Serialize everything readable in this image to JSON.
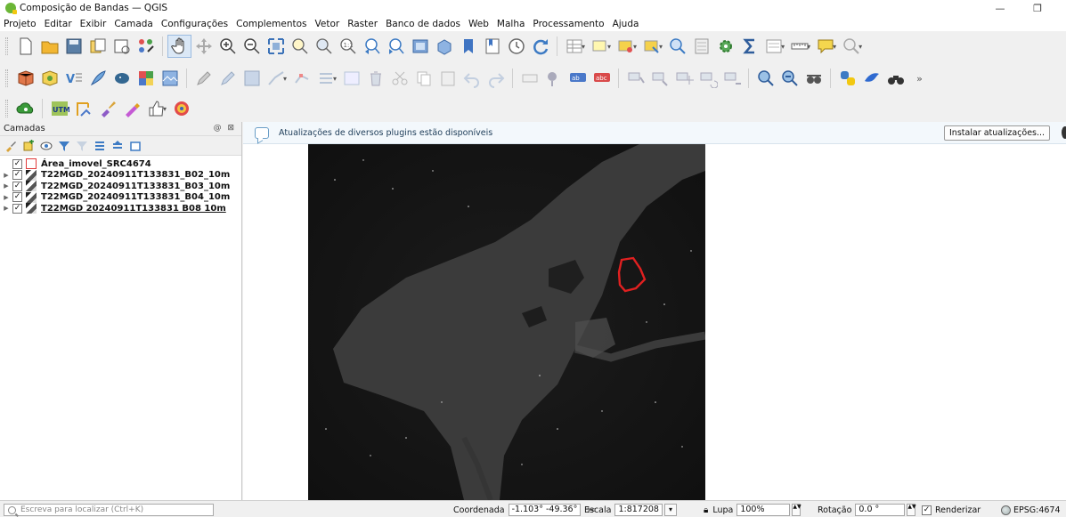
{
  "window": {
    "title": "Composição de Bandas — QGIS",
    "minimize_glyph": "—",
    "restore_glyph": "❐"
  },
  "menu": [
    "Projeto",
    "Editar",
    "Exibir",
    "Camada",
    "Configurações",
    "Complementos",
    "Vetor",
    "Raster",
    "Banco de dados",
    "Web",
    "Malha",
    "Processamento",
    "Ajuda"
  ],
  "layers_panel": {
    "title": "Camadas",
    "controls": "@ ⊠",
    "layers": [
      {
        "name": "Área_imovel_SRC4674",
        "checked": "✓",
        "type": "vector"
      },
      {
        "name": "T22MGD_20240911T133831_B02_10m",
        "checked": "✓",
        "type": "raster"
      },
      {
        "name": "T22MGD_20240911T133831_B03_10m",
        "checked": "✓",
        "type": "raster"
      },
      {
        "name": "T22MGD_20240911T133831_B04_10m",
        "checked": "✓",
        "type": "raster"
      },
      {
        "name": "T22MGD 20240911T133831 B08 10m",
        "checked": "✓",
        "type": "raster"
      }
    ]
  },
  "message_bar": {
    "text": "Atualizações de diversos plugins estão disponíveis",
    "button": "Instalar atualizações..."
  },
  "status": {
    "locator_placeholder": "Escreva para localizar (Ctrl+K)",
    "coord_label": "Coordenada",
    "coord_value": "-1.103° -49.36°",
    "scale_label": "Escala",
    "scale_value": "1:817208",
    "magnifier_label": "Lupa",
    "magnifier_value": "100%",
    "rotation_label": "Rotação",
    "rotation_value": "0.0 °",
    "render_label": "Renderizar",
    "render_checked": "✓",
    "crs": "EPSG:4674"
  },
  "colors": {
    "polygon_outline": "#e02020",
    "water": "#3a3a3a",
    "land": "#141414"
  }
}
